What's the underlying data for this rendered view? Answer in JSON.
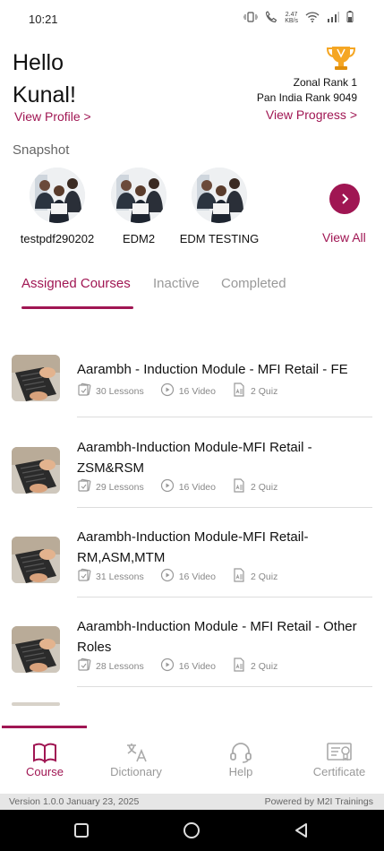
{
  "status_bar": {
    "time": "10:21",
    "speed": "2.47\nKB/s"
  },
  "header": {
    "greeting": "Hello Kunal!",
    "view_profile": "View Profile >",
    "zonal_rank": "Zonal Rank 1",
    "pan_india_rank": "Pan India Rank 9049",
    "view_progress": "View Progress >"
  },
  "snapshot": {
    "label": "Snapshot",
    "items": [
      {
        "name": "testpdf290202"
      },
      {
        "name": "EDM2"
      },
      {
        "name": "EDM TESTING"
      }
    ],
    "view_all": "View All"
  },
  "tabs": [
    {
      "label": "Assigned Courses",
      "active": true
    },
    {
      "label": "Inactive",
      "active": false
    },
    {
      "label": "Completed",
      "active": false
    }
  ],
  "courses": [
    {
      "title": "Aarambh - Induction Module - MFI Retail - FE",
      "lessons": "30 Lessons",
      "videos": "16 Video",
      "quiz": "2 Quiz"
    },
    {
      "title": "Aarambh-Induction Module-MFI Retail - ZSM&RSM",
      "lessons": "29 Lessons",
      "videos": "16 Video",
      "quiz": "2 Quiz"
    },
    {
      "title": "Aarambh-Induction Module-MFI Retail-RM,ASM,MTM",
      "lessons": "31 Lessons",
      "videos": "16 Video",
      "quiz": "2 Quiz"
    },
    {
      "title": "Aarambh-Induction Module - MFI Retail - Other Roles",
      "lessons": "28 Lessons",
      "videos": "16 Video",
      "quiz": "2 Quiz"
    }
  ],
  "bottom_nav": [
    {
      "label": "Course",
      "icon": "book-icon",
      "active": true
    },
    {
      "label": "Dictionary",
      "icon": "translate-icon",
      "active": false
    },
    {
      "label": "Help",
      "icon": "headset-icon",
      "active": false
    },
    {
      "label": "Certificate",
      "icon": "certificate-icon",
      "active": false
    }
  ],
  "footer": {
    "version": "Version 1.0.0 January 23, 2025",
    "powered_by": "Powered by M2I Trainings"
  },
  "colors": {
    "accent": "#a01653",
    "muted": "#999999"
  }
}
